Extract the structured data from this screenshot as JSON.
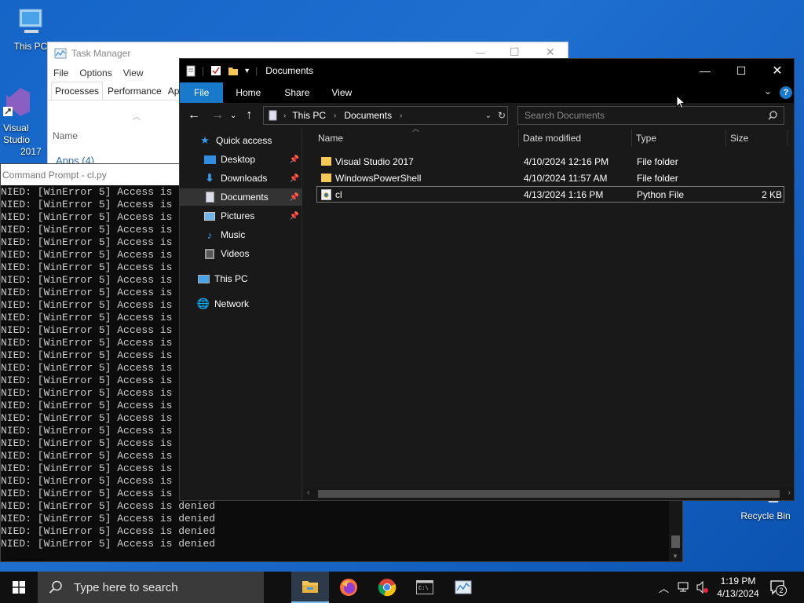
{
  "desktop": {
    "this_pc_label": "This PC",
    "vs_label_1": "Visual Studio",
    "vs_label_2": "2017",
    "recycle_bin_label": "Recycle Bin"
  },
  "task_manager": {
    "title": "Task Manager",
    "menu": [
      "File",
      "Options",
      "View"
    ],
    "tabs": [
      "Processes",
      "Performance",
      "Ap"
    ],
    "column_name": "Name",
    "group_partial": "Apps (4)"
  },
  "cmd": {
    "title": "Command Prompt - cl.py",
    "line_truncated": "NIED: [WinError 5] Access is",
    "line_full": "NIED: [WinError 5] Access is denied",
    "truncated_count": 25,
    "full_count": 4
  },
  "explorer": {
    "title": "Documents",
    "ribbon_tabs": [
      "File",
      "Home",
      "Share",
      "View"
    ],
    "help_label": "?",
    "breadcrumb": [
      "This PC",
      "Documents"
    ],
    "search_placeholder": "Search Documents",
    "nav": {
      "quick_access": "Quick access",
      "desktop": "Desktop",
      "downloads": "Downloads",
      "documents": "Documents",
      "pictures": "Pictures",
      "music": "Music",
      "videos": "Videos",
      "this_pc": "This PC",
      "network": "Network"
    },
    "columns": [
      "Name",
      "Date modified",
      "Type",
      "Size"
    ],
    "files": [
      {
        "name": "Visual Studio 2017",
        "date": "4/10/2024 12:16 PM",
        "type": "File folder",
        "size": "",
        "icon": "folder-icon"
      },
      {
        "name": "WindowsPowerShell",
        "date": "4/10/2024 11:57 AM",
        "type": "File folder",
        "size": "",
        "icon": "folder-icon"
      },
      {
        "name": "cl",
        "date": "4/13/2024 1:16 PM",
        "type": "Python File",
        "size": "2 KB",
        "icon": "python-file-icon"
      }
    ]
  },
  "taskbar": {
    "search_placeholder": "Type here to search",
    "time": "1:19 PM",
    "date": "4/13/2024",
    "notification_count": "2"
  },
  "colors": {
    "desktop_bg": "#1565c8",
    "explorer_bg": "#191919",
    "accent": "#1979ca",
    "taskbar_bg": "#101010"
  }
}
